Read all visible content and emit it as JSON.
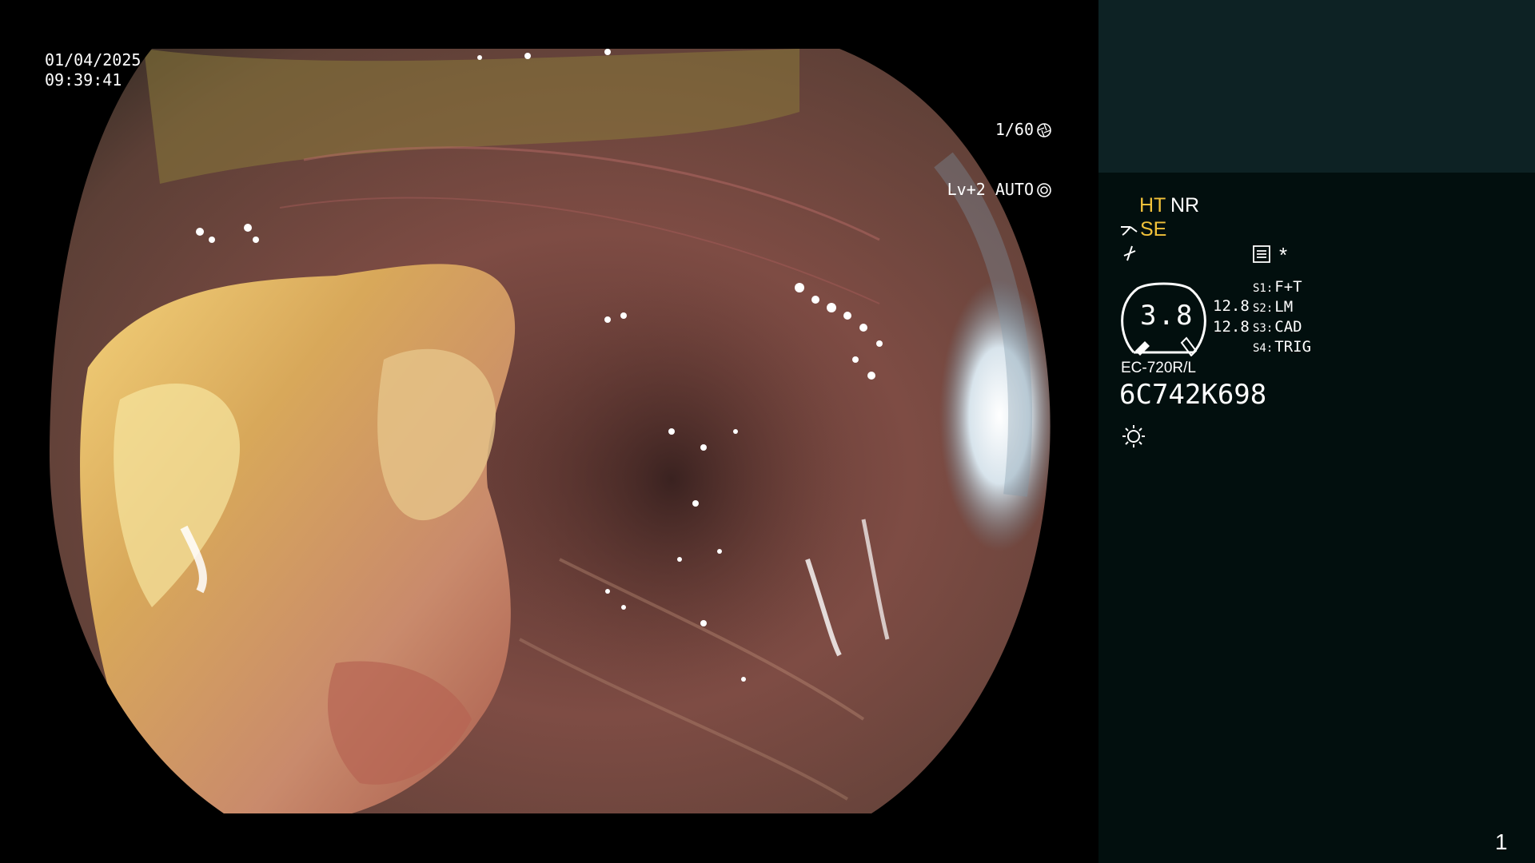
{
  "view": {
    "date": "01/04/2025",
    "time": "09:39:41",
    "shutter": "1/60",
    "shutter_icon": "aperture-icon",
    "enhance": "Lv+2 AUTO",
    "enhance_icon": "iris-auto-icon"
  },
  "panel": {
    "mode_ht": "HT",
    "mode_nr": "NR",
    "mode_se": "SE",
    "star": "*",
    "gauge_value": "3.8",
    "value_1": "12.8",
    "value_2": "12.8",
    "switches": [
      {
        "key": "S1:",
        "label": "F+T"
      },
      {
        "key": "S2:",
        "label": "LM"
      },
      {
        "key": "S3:",
        "label": "CAD"
      },
      {
        "key": "S4:",
        "label": "TRIG"
      }
    ],
    "scope_model": "EC-720R/L",
    "scope_serial": "6C742K698",
    "page_number": "1",
    "colors": {
      "accent_yellow": "#f2c23a",
      "panel_bg": "#020f0e",
      "panel_top_bg": "#0d2224"
    }
  }
}
